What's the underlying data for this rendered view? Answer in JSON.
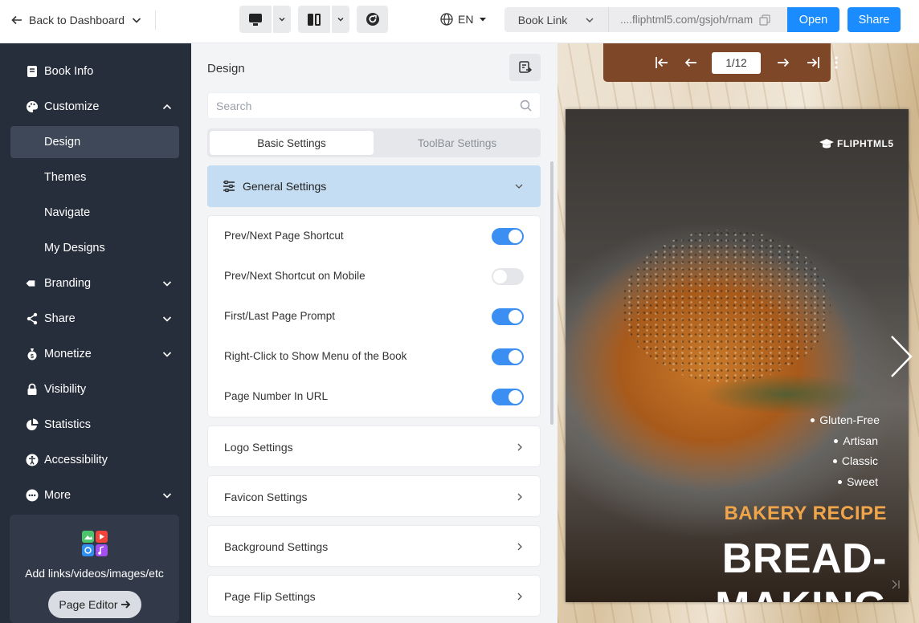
{
  "topbar": {
    "back_label": "Back to Dashboard",
    "language": "EN",
    "book_link_label": "Book Link",
    "book_url": "....fliphtml5.com/gsjoh/rnam",
    "open_label": "Open",
    "share_label": "Share"
  },
  "sidebar": {
    "items": [
      {
        "label": "Book Info",
        "icon": "book-icon"
      },
      {
        "label": "Customize",
        "icon": "palette-icon"
      },
      {
        "label": "Design"
      },
      {
        "label": "Themes"
      },
      {
        "label": "Navigate"
      },
      {
        "label": "My Designs"
      },
      {
        "label": "Branding",
        "icon": "tag-icon"
      },
      {
        "label": "Share",
        "icon": "share-icon"
      },
      {
        "label": "Monetize",
        "icon": "money-bag-icon"
      },
      {
        "label": "Visibility",
        "icon": "lock-icon"
      },
      {
        "label": "Statistics",
        "icon": "pie-chart-icon"
      },
      {
        "label": "Accessibility",
        "icon": "accessibility-icon"
      },
      {
        "label": "More",
        "icon": "more-dots-icon"
      }
    ],
    "active": "Design",
    "promo_text": "Add links/videos/images/etc",
    "promo_button": "Page Editor"
  },
  "panel": {
    "title": "Design",
    "search_placeholder": "Search",
    "tabs": [
      "Basic Settings",
      "ToolBar Settings"
    ],
    "active_tab": "Basic Settings",
    "general_section": "General Settings",
    "toggles": [
      {
        "label": "Prev/Next Page Shortcut",
        "on": true
      },
      {
        "label": "Prev/Next Shortcut on Mobile",
        "on": false
      },
      {
        "label": "First/Last Page Prompt",
        "on": true
      },
      {
        "label": "Right-Click to Show Menu of the Book",
        "on": true
      },
      {
        "label": "Page Number In URL",
        "on": true
      }
    ],
    "sections": [
      "Logo Settings",
      "Favicon Settings",
      "Background Settings",
      "Page Flip Settings"
    ]
  },
  "preview": {
    "page_indicator": "1/12",
    "logo_text": "FLIPHTML5",
    "bullets": [
      "Gluten-Free",
      "Artisan",
      "Classic",
      "Sweet"
    ],
    "subtitle": "BAKERY RECIPE",
    "title": "BREAD-MAKING"
  },
  "colors": {
    "accent": "#1a8cff",
    "sidebar_bg": "#272e3b",
    "toggle_on": "#3b8ef2",
    "toolbar_brown": "#7e4728",
    "recipe_orange": "#f0a54a"
  }
}
